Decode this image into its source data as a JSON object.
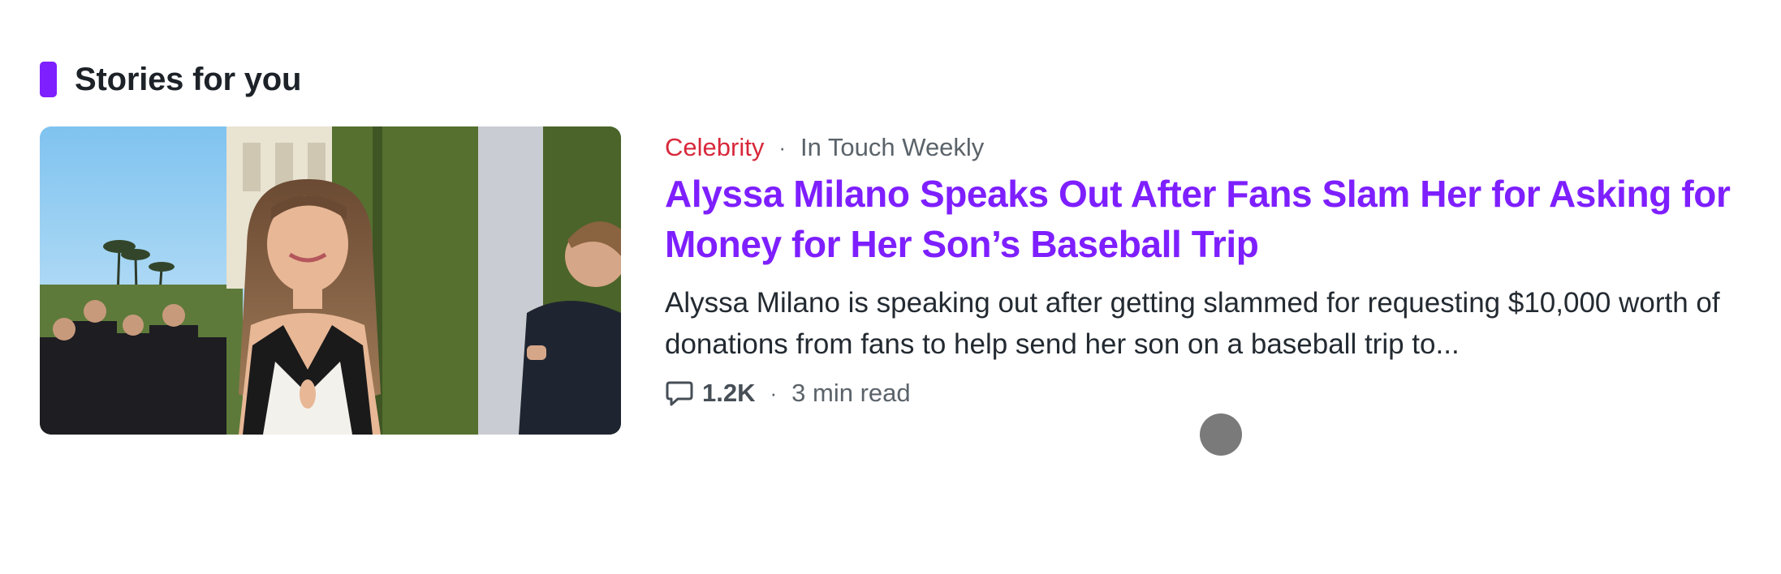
{
  "section": {
    "title": "Stories for you",
    "accent_color": "#7e1fff"
  },
  "story": {
    "category": "Celebrity",
    "separator": "·",
    "provider": "In Touch Weekly",
    "headline": "Alyssa Milano Speaks Out After Fans Slam Her for Asking for Money for Her Son’s Baseball Trip",
    "summary": "Alyssa Milano is speaking out after getting slammed for requesting $10,000 worth of donations from fans to help send her son on a baseball trip to...",
    "comment_count": "1.2K",
    "read_time": "3 min read",
    "comment_icon": "comment-bubble-icon",
    "headline_color": "#7e1fff",
    "category_color": "#d8283b"
  }
}
